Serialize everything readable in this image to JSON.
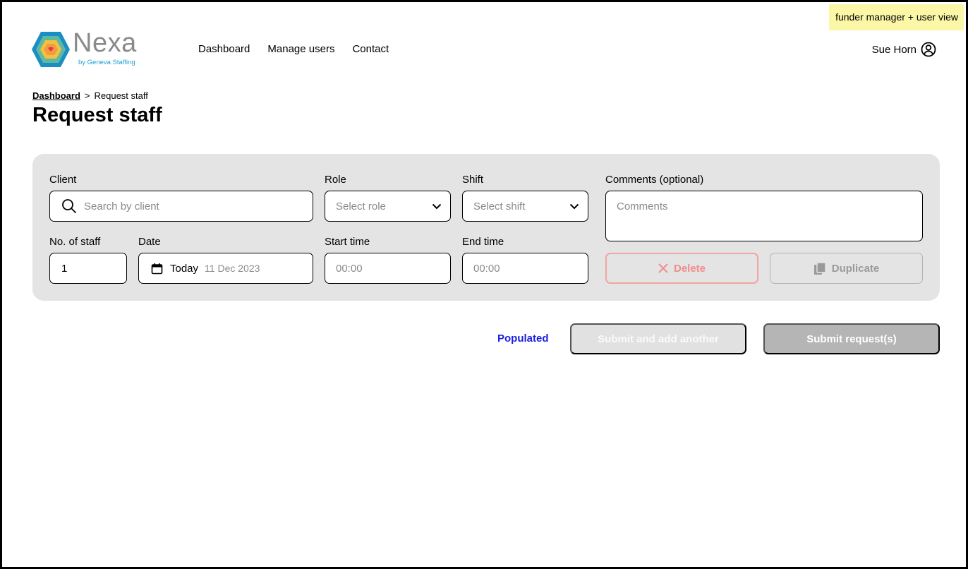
{
  "view_badge": "funder manager + user view",
  "logo": {
    "brand": "Nexa",
    "by": "by Geneva Staffing"
  },
  "nav": {
    "dashboard": "Dashboard",
    "manage_users": "Manage users",
    "contact": "Contact"
  },
  "user": {
    "name": "Sue Horn"
  },
  "breadcrumb": {
    "root": "Dashboard",
    "sep": ">",
    "current": "Request staff"
  },
  "page_title": "Request staff",
  "form": {
    "client": {
      "label": "Client",
      "placeholder": "Search by client"
    },
    "role": {
      "label": "Role",
      "placeholder": "Select role"
    },
    "shift": {
      "label": "Shift",
      "placeholder": "Select shift"
    },
    "comments": {
      "label": "Comments (optional)",
      "placeholder": "Comments"
    },
    "staff": {
      "label": "No. of staff",
      "value": "1"
    },
    "date": {
      "label": "Date",
      "today": "Today",
      "value": "11 Dec 2023"
    },
    "start_time": {
      "label": "Start time",
      "placeholder": "00:00"
    },
    "end_time": {
      "label": "End time",
      "placeholder": "00:00"
    },
    "delete_label": "Delete",
    "duplicate_label": "Duplicate"
  },
  "actions": {
    "status": "Populated",
    "submit_another": "Submit and add another",
    "submit": "Submit request(s)"
  },
  "colors": {
    "panel": "#e4e4e4",
    "status": "#1a22e0",
    "delete": "#f28c8c",
    "badge": "#fbf7a6"
  }
}
